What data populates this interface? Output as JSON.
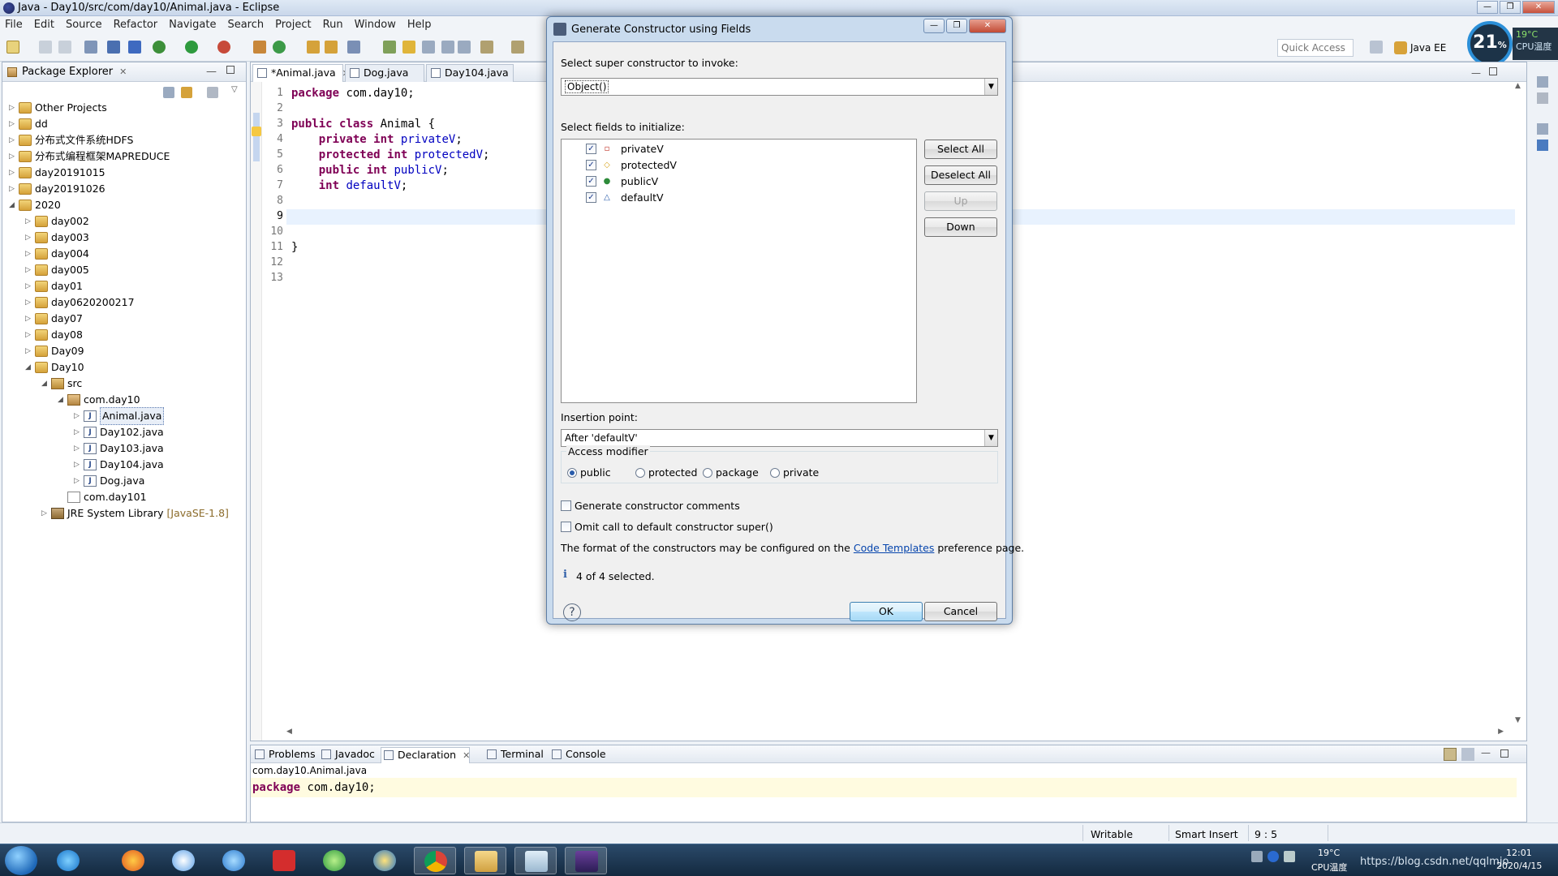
{
  "window": {
    "title": "Java - Day10/src/com/day10/Animal.java - Eclipse"
  },
  "menu": [
    "File",
    "Edit",
    "Source",
    "Refactor",
    "Navigate",
    "Search",
    "Project",
    "Run",
    "Window",
    "Help"
  ],
  "toolbar": {
    "quick_access": "Quick Access",
    "perspective": "Java EE"
  },
  "cpu_widget": {
    "percent": "21",
    "percent_sign": "%",
    "temp": "19°C",
    "label": "CPU温度"
  },
  "package_explorer": {
    "title": "Package Explorer",
    "nodes": [
      {
        "label": "Other Projects"
      },
      {
        "label": "dd"
      },
      {
        "label": "分布式文件系统HDFS"
      },
      {
        "label": "分布式编程框架MAPREDUCE"
      },
      {
        "label": "day20191015"
      },
      {
        "label": "day20191026"
      },
      {
        "label": "2020"
      },
      {
        "label": "day002"
      },
      {
        "label": "day003"
      },
      {
        "label": "day004"
      },
      {
        "label": "day005"
      },
      {
        "label": "day01"
      },
      {
        "label": "day0620200217"
      },
      {
        "label": "day07"
      },
      {
        "label": "day08"
      },
      {
        "label": "Day09"
      },
      {
        "label": "Day10"
      },
      {
        "label": "src"
      },
      {
        "label": "com.day10"
      },
      {
        "label": "Animal.java"
      },
      {
        "label": "Day102.java"
      },
      {
        "label": "Day103.java"
      },
      {
        "label": "Day104.java"
      },
      {
        "label": "Dog.java"
      },
      {
        "label": "com.day101"
      },
      {
        "label": "JRE System Library",
        "decoration": "[JavaSE-1.8]"
      }
    ]
  },
  "editor": {
    "tabs": [
      {
        "label": "*Animal.java",
        "active": true
      },
      {
        "label": "Dog.java",
        "active": false
      },
      {
        "label": "Day104.java",
        "active": false
      }
    ],
    "line_numbers": [
      "1",
      "2",
      "3",
      "4",
      "5",
      "6",
      "7",
      "8",
      "9",
      "10",
      "11",
      "12",
      "13"
    ],
    "code": {
      "l1_kw": "package",
      "l1_rest": " com.day10;",
      "l3_kw1": "public",
      "l3_kw2": "class",
      "l3_rest": " Animal {",
      "l4_kw1": "private",
      "l4_kw2": "int",
      "l4_field": "privateV",
      "l4_end": ";",
      "l5_kw1": "protected",
      "l5_kw2": "int",
      "l5_field": "protectedV",
      "l5_end": ";",
      "l6_kw1": "public",
      "l6_kw2": "int",
      "l6_field": "publicV",
      "l6_end": ";",
      "l7_kw": "int",
      "l7_field": "defaultV",
      "l7_end": ";",
      "l11": "}"
    }
  },
  "bottom_panel": {
    "tabs": [
      "Problems",
      "Javadoc",
      "Declaration",
      "Terminal",
      "Console"
    ],
    "active_tab": "Declaration",
    "path": "com.day10.Animal.java",
    "code_kw": "package",
    "code_rest": " com.day10;"
  },
  "status_bar": {
    "writable": "Writable",
    "insert_mode": "Smart Insert",
    "position": "9 : 5"
  },
  "taskbar": {
    "tray_temp": "19°C",
    "tray_temp_label": "CPU温度",
    "time": "12:01",
    "date": "2020/4/15",
    "watermark": "https://blog.csdn.net/qqlmjo"
  },
  "dialog": {
    "title": "Generate Constructor using Fields",
    "super_label": "Select super constructor to invoke:",
    "super_value": "Object()",
    "fields_label": "Select fields to initialize:",
    "fields": [
      {
        "name": "privateV",
        "visibility_icon": "▫",
        "color": "#c2362b",
        "checked": true
      },
      {
        "name": "protectedV",
        "visibility_icon": "◇",
        "color": "#d8a520",
        "checked": true
      },
      {
        "name": "publicV",
        "visibility_icon": "●",
        "color": "#2e8b3a",
        "checked": true
      },
      {
        "name": "defaultV",
        "visibility_icon": "△",
        "color": "#2a5caa",
        "checked": true
      }
    ],
    "buttons": {
      "select_all": "Select All",
      "deselect_all": "Deselect All",
      "up": "Up",
      "down": "Down",
      "ok": "OK",
      "cancel": "Cancel"
    },
    "insertion_label": "Insertion point:",
    "insertion_value": "After 'defaultV'",
    "access_group": "Access modifier",
    "access_options": [
      "public",
      "protected",
      "package",
      "private"
    ],
    "access_selected": "public",
    "gen_comments": "Generate constructor comments",
    "omit_super": "Omit call to default constructor super()",
    "format_text_before": "The format of the constructors may be configured on the ",
    "format_link": "Code Templates",
    "format_text_after": " preference page.",
    "selection_status": "4 of 4 selected."
  }
}
